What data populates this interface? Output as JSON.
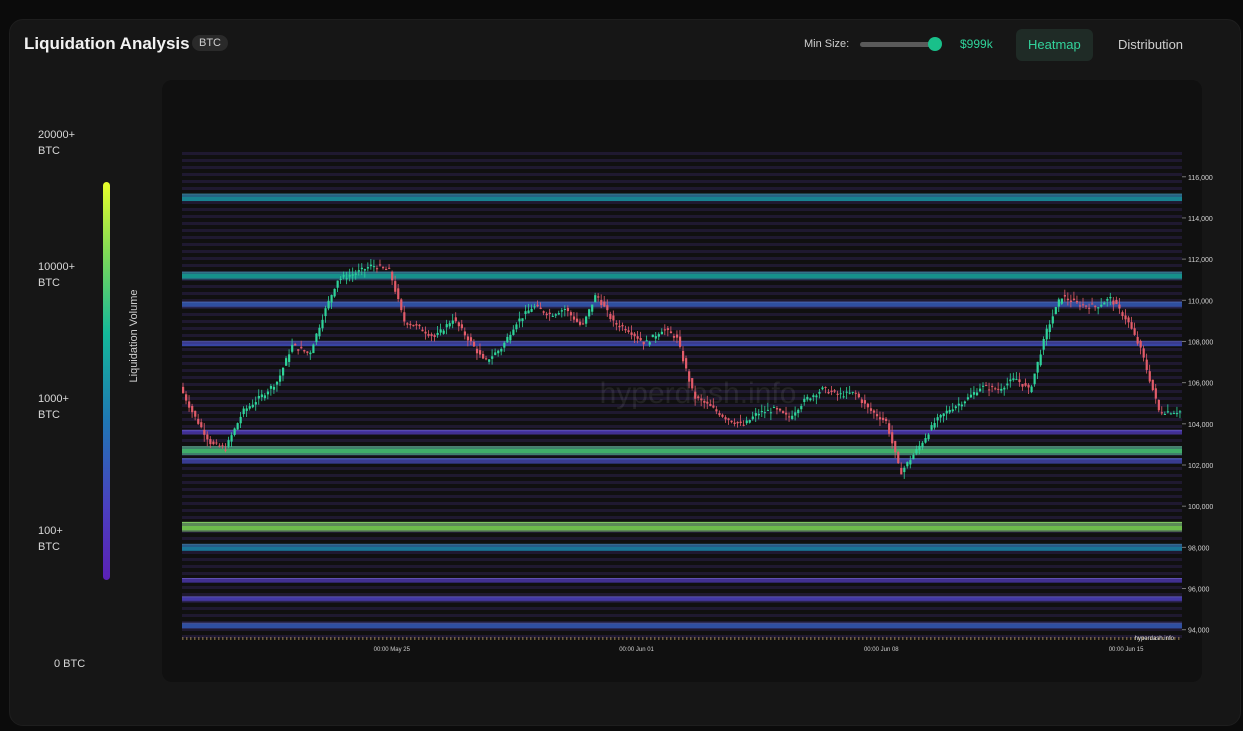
{
  "header": {
    "title": "Liquidation Analysis",
    "badge": "BTC",
    "min_size_label": "Min Size:",
    "min_size_value": "$999k",
    "min_size_slider_level": 1.0,
    "tabs": [
      {
        "label": "Heatmap",
        "active": true
      },
      {
        "label": "Distribution",
        "active": false
      }
    ]
  },
  "legend": {
    "axis_title": "Liquidation Volume",
    "levels": [
      "20000+ BTC",
      "10000+ BTC",
      "1000+ BTC",
      "100+ BTC",
      "0 BTC"
    ],
    "levels_lines": [
      [
        "20000+",
        "BTC"
      ],
      [
        "10000+",
        "BTC"
      ],
      [
        "1000+",
        "BTC"
      ],
      [
        "100+",
        "BTC"
      ],
      [
        "0 BTC"
      ]
    ]
  },
  "colors": {
    "accent": "#19c08a",
    "up_candle": "#2fd39a",
    "down_candle": "#e25c6a",
    "low_volume": "#5b21b6",
    "high_volume": "#e8ff2a"
  },
  "chart_data": {
    "type": "heatmap",
    "watermark": "hyperdash.info",
    "corner_mark": "hyperdash.info",
    "x_tick_labels": [
      "00:00 May 25",
      "00:00 Jun 01",
      "00:00 Jun 08",
      "00:00 Jun 15"
    ],
    "y_tick_labels": [
      "116,000",
      "114,000",
      "112,000",
      "110,000",
      "108,000",
      "106,000",
      "104,000",
      "102,000",
      "100,000",
      "98,000",
      "96,000",
      "94,000"
    ],
    "y_ticks": [
      116000,
      114000,
      112000,
      110000,
      108000,
      106000,
      104000,
      102000,
      100000,
      98000,
      96000,
      94000
    ],
    "ylim": [
      93500,
      117300
    ],
    "x_range": [
      "May 19",
      "Jun 17"
    ],
    "x_ticks_days": [
      6,
      13,
      20,
      27
    ],
    "x_span_days": 28.6,
    "bands": [
      {
        "price": 115000,
        "level": 0.55
      },
      {
        "price": 111200,
        "level": 0.6
      },
      {
        "price": 109800,
        "level": 0.35
      },
      {
        "price": 107900,
        "level": 0.3
      },
      {
        "price": 103600,
        "level": 0.2
      },
      {
        "price": 102700,
        "level": 0.75
      },
      {
        "price": 102200,
        "level": 0.3
      },
      {
        "price": 99000,
        "level": 0.85
      },
      {
        "price": 98000,
        "level": 0.5
      },
      {
        "price": 96400,
        "level": 0.2
      },
      {
        "price": 95500,
        "level": 0.25
      },
      {
        "price": 94200,
        "level": 0.35
      }
    ],
    "price_path": [
      [
        0.0,
        105800
      ],
      [
        0.4,
        104400
      ],
      [
        0.9,
        103000
      ],
      [
        1.3,
        102800
      ],
      [
        1.8,
        104600
      ],
      [
        2.3,
        105300
      ],
      [
        2.8,
        106100
      ],
      [
        3.2,
        107800
      ],
      [
        3.7,
        107400
      ],
      [
        4.1,
        109300
      ],
      [
        4.5,
        111000
      ],
      [
        5.0,
        111300
      ],
      [
        5.5,
        111700
      ],
      [
        6.0,
        111400
      ],
      [
        6.4,
        109000
      ],
      [
        6.9,
        108600
      ],
      [
        7.3,
        108200
      ],
      [
        7.8,
        109100
      ],
      [
        8.3,
        108000
      ],
      [
        8.7,
        107000
      ],
      [
        9.2,
        107700
      ],
      [
        9.6,
        108900
      ],
      [
        10.1,
        109700
      ],
      [
        10.6,
        109300
      ],
      [
        11.0,
        109600
      ],
      [
        11.5,
        108700
      ],
      [
        11.9,
        110300
      ],
      [
        12.4,
        108900
      ],
      [
        12.8,
        108600
      ],
      [
        13.3,
        107900
      ],
      [
        13.8,
        108600
      ],
      [
        14.2,
        108200
      ],
      [
        14.7,
        105300
      ],
      [
        15.1,
        104900
      ],
      [
        15.6,
        104300
      ],
      [
        16.1,
        103900
      ],
      [
        16.5,
        104500
      ],
      [
        17.0,
        104700
      ],
      [
        17.4,
        104300
      ],
      [
        17.9,
        105200
      ],
      [
        18.4,
        105700
      ],
      [
        18.8,
        105400
      ],
      [
        19.3,
        105500
      ],
      [
        19.7,
        104700
      ],
      [
        20.2,
        104100
      ],
      [
        20.6,
        101600
      ],
      [
        21.1,
        102800
      ],
      [
        21.6,
        104100
      ],
      [
        22.0,
        104700
      ],
      [
        22.5,
        105200
      ],
      [
        22.9,
        105800
      ],
      [
        23.4,
        105700
      ],
      [
        23.9,
        106200
      ],
      [
        24.3,
        105600
      ],
      [
        24.8,
        108600
      ],
      [
        25.2,
        110200
      ],
      [
        25.7,
        109800
      ],
      [
        26.2,
        109700
      ],
      [
        26.6,
        110100
      ],
      [
        27.1,
        109000
      ],
      [
        27.5,
        107500
      ],
      [
        28.0,
        104600
      ],
      [
        28.6,
        104600
      ]
    ]
  }
}
